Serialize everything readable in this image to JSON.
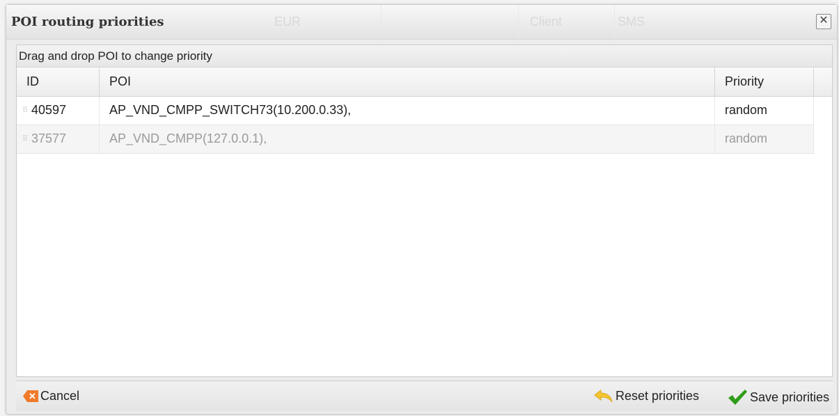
{
  "dialog": {
    "title": "POI routing priorities",
    "close_glyph": "✕",
    "close_icon": "close-icon"
  },
  "background": {
    "ghost_labels": [
      "EUR",
      "Client",
      "SMS"
    ]
  },
  "panel": {
    "hint": "Drag and drop POI to change priority"
  },
  "table": {
    "columns": [
      "ID",
      "POI",
      "Priority"
    ],
    "rows": [
      {
        "id": "40597",
        "poi": "AP_VND_CMPP_SWITCH73(10.200.0.33),",
        "priority": "random",
        "disabled": false
      },
      {
        "id": "37577",
        "poi": "AP_VND_CMPP(127.0.0.1),",
        "priority": "random",
        "disabled": true
      }
    ],
    "drag_handle_icon": "drag-handle-icon"
  },
  "footer": {
    "cancel_label": "Cancel",
    "cancel_icon": "cancel-icon",
    "reset_label": "Reset priorities",
    "reset_icon": "undo-arrow-icon",
    "save_label": "Save priorities",
    "save_icon": "checkmark-icon"
  },
  "colors": {
    "cancel_accent": "#ee7a2a",
    "reset_accent": "#f2c531",
    "save_accent": "#2e9c1a",
    "disabled_text": "#9a9a9a"
  }
}
